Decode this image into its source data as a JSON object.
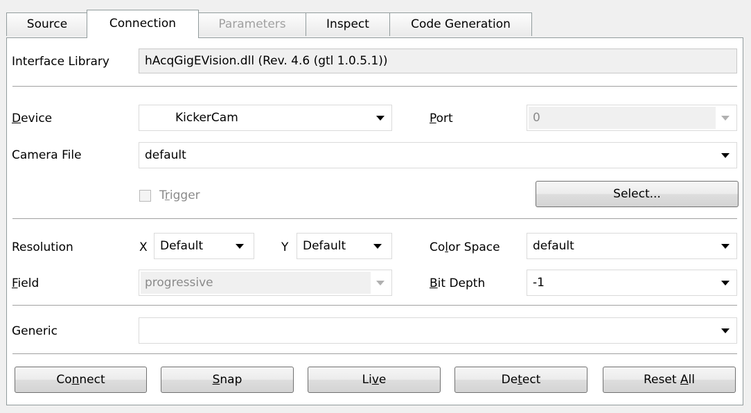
{
  "tabs": [
    {
      "label": "Source"
    },
    {
      "label": "Connection"
    },
    {
      "label": "Parameters"
    },
    {
      "label": "Inspect"
    },
    {
      "label": "Code Generation"
    }
  ],
  "interface_library": {
    "label": "Interface Library",
    "value": "hAcqGigEVision.dll (Rev. 4.6 (gtl 1.0.5.1))"
  },
  "device": {
    "label_mnemonic": "D",
    "label_rest": "evice",
    "value": "KickerCam"
  },
  "port": {
    "label_mnemonic": "P",
    "label_rest": "ort",
    "value": "0"
  },
  "camera_file": {
    "label": "Camera File",
    "value": "default"
  },
  "trigger": {
    "label_pre": "T",
    "label_mnemonic": "r",
    "label_rest": "igger",
    "checked": false
  },
  "select_button": {
    "label": "Select..."
  },
  "resolution": {
    "label": "Resolution",
    "x_label": "X",
    "x_value": "Default",
    "y_label": "Y",
    "y_value": "Default"
  },
  "color_space": {
    "label_pre": "Co",
    "label_mnemonic": "l",
    "label_rest": "or Space",
    "value": "default"
  },
  "field": {
    "label_mnemonic": "F",
    "label_rest": "ield",
    "value": "progressive"
  },
  "bit_depth": {
    "label_mnemonic": "B",
    "label_rest": "it Depth",
    "value": "-1"
  },
  "generic": {
    "label": "Generic",
    "value": ""
  },
  "buttons": {
    "connect": {
      "pre": "Co",
      "mnemonic": "n",
      "rest": "nect"
    },
    "snap": {
      "pre": "",
      "mnemonic": "S",
      "rest": "nap"
    },
    "live": {
      "pre": "Li",
      "mnemonic": "v",
      "rest": "e"
    },
    "detect": {
      "pre": "De",
      "mnemonic": "t",
      "rest": "ect"
    },
    "reset_all": {
      "pre": "Reset ",
      "mnemonic": "A",
      "rest": "ll"
    }
  }
}
